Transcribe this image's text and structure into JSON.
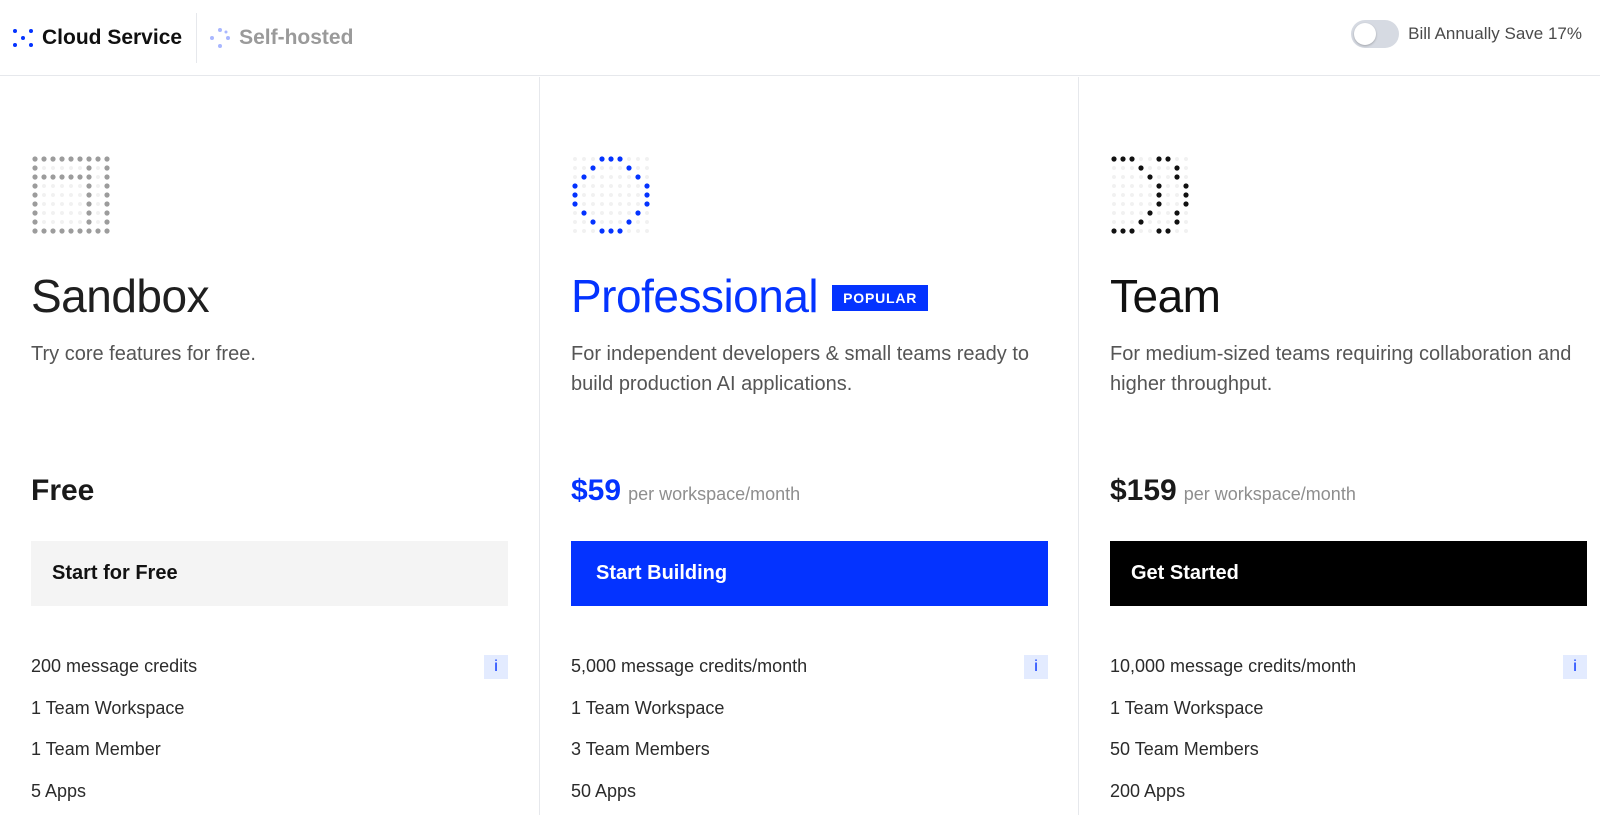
{
  "header": {
    "tabs": [
      {
        "label": "Cloud Service",
        "icon": "dots-icon",
        "active": true
      },
      {
        "label": "Self-hosted",
        "icon": "dots-icon",
        "active": false
      }
    ],
    "billing": {
      "label": "Bill Annually Save 17%",
      "toggle_on": false
    }
  },
  "colors": {
    "accent": "#0433ff",
    "muted_text": "#8e8e8e",
    "border": "#e6e8ec"
  },
  "plans": [
    {
      "name": "Sandbox",
      "description": "Try core features for free.",
      "price": "Free",
      "price_unit": "",
      "cta": "Start for Free",
      "features": [
        "200 message credits",
        "1 Team Workspace",
        "1 Team Member",
        "5 Apps"
      ],
      "info_label": "i"
    },
    {
      "name": "Professional",
      "badge": "POPULAR",
      "description": "For independent developers & small teams ready to build production AI applications.",
      "price": "$59",
      "price_unit": "per workspace/month",
      "cta": "Start Building",
      "features": [
        "5,000 message credits/month",
        "1 Team Workspace",
        "3 Team Members",
        "50 Apps"
      ],
      "info_label": "i"
    },
    {
      "name": "Team",
      "description": "For medium-sized teams requiring collaboration and higher throughput.",
      "price": "$159",
      "price_unit": "per workspace/month",
      "cta": "Get Started",
      "features": [
        "10,000 message credits/month",
        "1 Team Workspace",
        "50 Team Members",
        "200 Apps"
      ],
      "info_label": "i"
    }
  ]
}
